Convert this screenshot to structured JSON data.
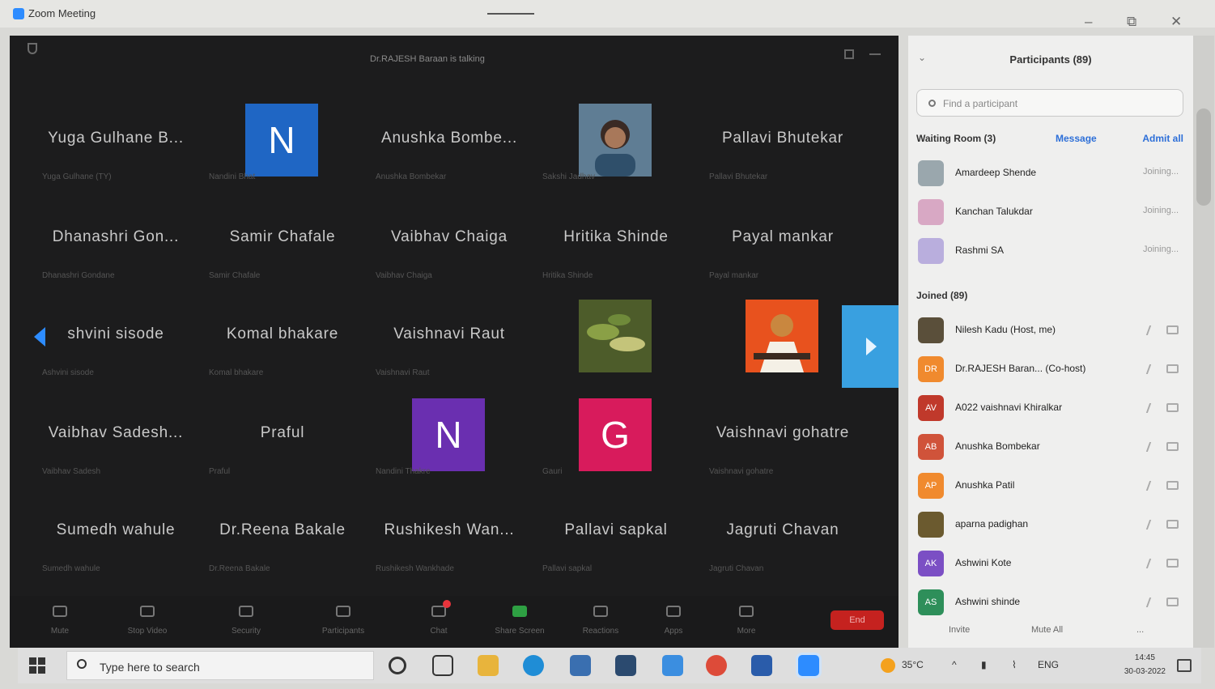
{
  "window": {
    "title": "Zoom Meeting",
    "minimize": "–",
    "restore": "⧉",
    "close": "✕"
  },
  "meeting": {
    "talking": "Dr.RAJESH Baraan is talking"
  },
  "tiles": [
    {
      "name": "Yuga Gulhane B...",
      "sub": "Yuga Gulhane (TY)",
      "type": "text"
    },
    {
      "name": "",
      "sub": "Nandini Bhat",
      "type": "avatar",
      "letter": "N",
      "color": "#1f66c4"
    },
    {
      "name": "Anushka Bombe...",
      "sub": "Anushka Bombekar",
      "type": "text"
    },
    {
      "name": "",
      "sub": "Sakshi Jadhav",
      "type": "photo"
    },
    {
      "name": "Pallavi Bhutekar",
      "sub": "Pallavi Bhutekar",
      "type": "text"
    },
    {
      "name": "Dhanashri Gon...",
      "sub": "Dhanashri Gondane",
      "type": "text"
    },
    {
      "name": "Samir Chafale",
      "sub": "Samir Chafale",
      "type": "text"
    },
    {
      "name": "Vaibhav Chaiga",
      "sub": "Vaibhav Chaiga",
      "type": "text"
    },
    {
      "name": "Hritika Shinde",
      "sub": "Hritika Shinde",
      "type": "text"
    },
    {
      "name": "Payal mankar",
      "sub": "Payal mankar",
      "type": "text"
    },
    {
      "name": "shvini sisode",
      "sub": "Ashvini sisode",
      "type": "text"
    },
    {
      "name": "Komal bhakare",
      "sub": "Komal bhakare",
      "type": "text"
    },
    {
      "name": "Vaishnavi Raut",
      "sub": "Vaishnavi Raut",
      "type": "text"
    },
    {
      "name": "",
      "sub": "",
      "type": "photo-green"
    },
    {
      "name": "",
      "sub": "",
      "type": "photo-orange"
    },
    {
      "name": "Vaibhav Sadesh...",
      "sub": "Vaibhav Sadesh",
      "type": "text"
    },
    {
      "name": "Praful",
      "sub": "Praful",
      "type": "text"
    },
    {
      "name": "",
      "sub": "Nandini Thakre",
      "type": "avatar",
      "letter": "N",
      "color": "#6a2fb0"
    },
    {
      "name": "",
      "sub": "Gauri",
      "type": "avatar",
      "letter": "G",
      "color": "#d81b5c"
    },
    {
      "name": "Vaishnavi gohatre",
      "sub": "Vaishnavi gohatre",
      "type": "text"
    },
    {
      "name": "Sumedh wahule",
      "sub": "Sumedh wahule",
      "type": "text"
    },
    {
      "name": "Dr.Reena Bakale",
      "sub": "Dr.Reena Bakale",
      "type": "text"
    },
    {
      "name": "Rushikesh Wan...",
      "sub": "Rushikesh Wankhade",
      "type": "text"
    },
    {
      "name": "Pallavi sapkal",
      "sub": "Pallavi sapkal",
      "type": "text"
    },
    {
      "name": "Jagruti Chavan",
      "sub": "Jagruti Chavan",
      "type": "text"
    }
  ],
  "toolbar": {
    "mute": "Mute",
    "stop_video": "Stop Video",
    "security": "Security",
    "participants": "Participants",
    "chat": "Chat",
    "share_screen": "Share Screen",
    "reactions": "Reactions",
    "apps": "Apps",
    "more": "More",
    "end": "End"
  },
  "panel": {
    "title": "Participants (89)",
    "search_placeholder": "Find a participant",
    "waiting_room": "Waiting Room (3)",
    "message": "Message",
    "admit_all": "Admit all",
    "joined": "Joined (89)",
    "invite": "Invite",
    "mute_all": "Mute All",
    "more": "...",
    "waiting": [
      {
        "name": "Amardeep Shende",
        "status": "Joining...",
        "color": "#9aa7ad",
        "initials": ""
      },
      {
        "name": "Kanchan Talukdar",
        "status": "Joining...",
        "color": "#d8a8c4",
        "initials": ""
      },
      {
        "name": "Rashmi SA",
        "status": "Joining...",
        "color": "#b9aedd",
        "initials": ""
      }
    ],
    "joined_list": [
      {
        "name": "Nilesh Kadu (Host, me)",
        "color": "#5a4f3a",
        "initials": ""
      },
      {
        "name": "Dr.RAJESH Baran... (Co-host)",
        "color": "#f08a2e",
        "initials": "DR"
      },
      {
        "name": "A022 vaishnavi Khiralkar",
        "color": "#c0392b",
        "initials": "AV"
      },
      {
        "name": "Anushka Bombekar",
        "color": "#d0533a",
        "initials": "AB"
      },
      {
        "name": "Anushka Patil",
        "color": "#f08a2e",
        "initials": "AP"
      },
      {
        "name": "aparna padighan",
        "color": "#6b5a2f",
        "initials": ""
      },
      {
        "name": "Ashwini Kote",
        "color": "#7b4fc4",
        "initials": "AK"
      },
      {
        "name": "Ashwini shinde",
        "color": "#2e8f5a",
        "initials": "AS"
      }
    ]
  },
  "taskbar": {
    "search_text": "Type here to search",
    "temperature": "35°C",
    "lang": "ENG",
    "time": "14:45",
    "date": "30-03-2022"
  }
}
